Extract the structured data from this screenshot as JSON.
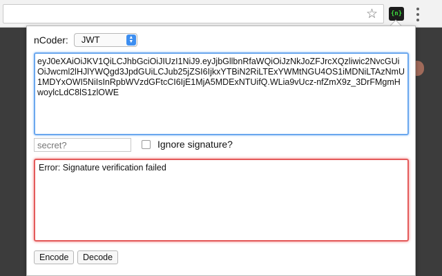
{
  "browser": {
    "star_icon": "star-icon",
    "extension_icon_text": "{n}",
    "menu_icon": "vertical-dots-icon"
  },
  "popup": {
    "coder_label": "nCoder:",
    "coder_selected": "JWT",
    "token_value": "eyJ0eXAiOiJKV1QiLCJhbGciOiJIUzI1NiJ9.eyJjbGllbnRfaWQiOiJzNkJoZFJrcXQzliwic2NvcGUiOiJwcml2lHJlYWQgd3JpdGUiLCJub25jZSI6IjkxYTBiN2RiLTExYWMtNGU4OS1iMDNiLTAzNmU1MDYxOWI5NiIsInRpbWVzdGFtcCI6IjE1MjA5MDExNTUifQ.WLia9vUcz-nfZmX9z_3DrFMgmHwoylcLdC8lS1zlOWE",
    "secret_placeholder": "secret?",
    "secret_value": "secret?",
    "ignore_label": "Ignore signature?",
    "error_text": "Error: Signature verification failed",
    "encode_label": "Encode",
    "decode_label": "Decode"
  },
  "colors": {
    "token_border": "#6aa7ee",
    "error_border": "#e45a5a",
    "select_accent": "#3d8ef0"
  }
}
